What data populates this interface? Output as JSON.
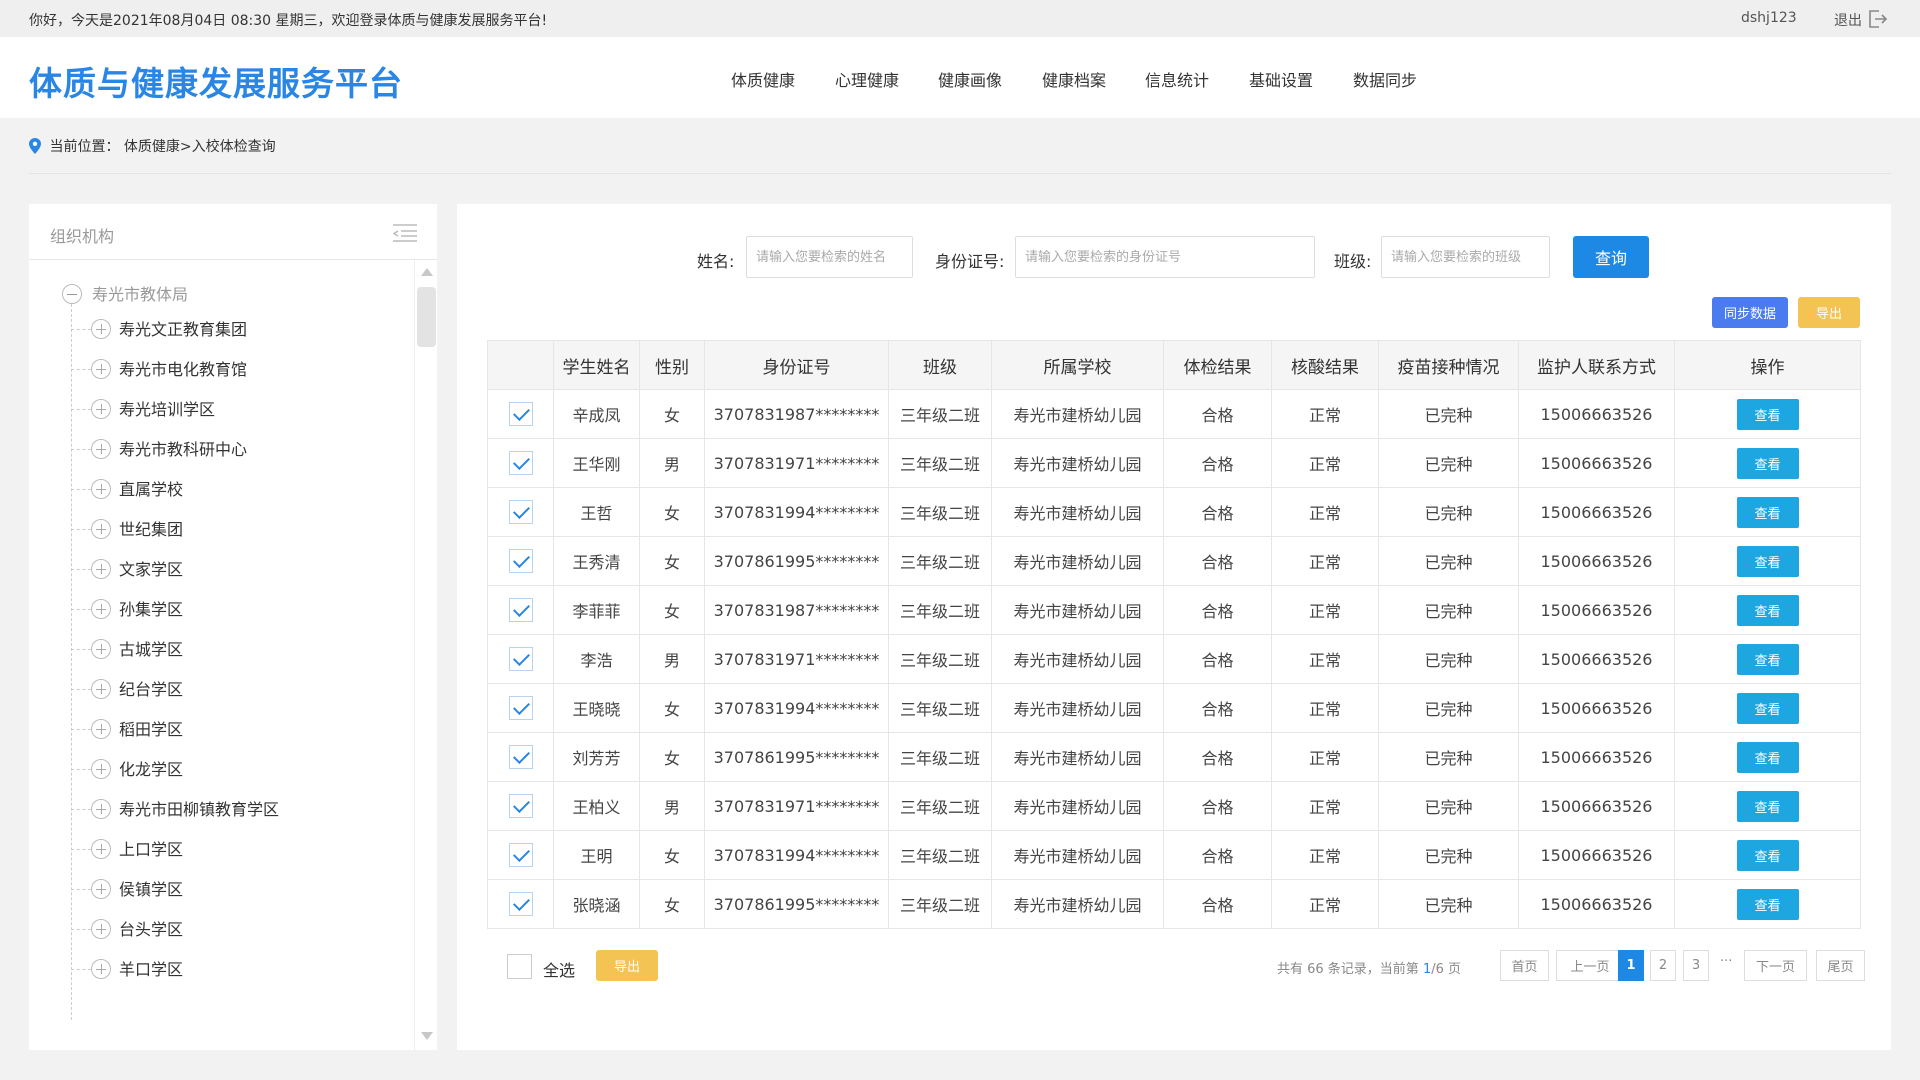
{
  "topbar": {
    "greeting": "你好，今天是2021年08月04日 08:30  星期三，欢迎登录体质与健康发展服务平台!",
    "username": "dshj123",
    "logout": "退出"
  },
  "brand": "体质与健康发展服务平台",
  "nav": [
    "体质健康",
    "心理健康",
    "健康画像",
    "健康档案",
    "信息统计",
    "基础设置",
    "数据同步"
  ],
  "breadcrumb": "当前位置：  体质健康>入校体检查询",
  "org": {
    "title": "组织机构",
    "root": "寿光市教体局",
    "items": [
      "寿光文正教育集团",
      "寿光市电化教育馆",
      "寿光培训学区",
      "寿光市教科研中心",
      "直属学校",
      "世纪集团",
      "文家学区",
      "孙集学区",
      "古城学区",
      "纪台学区",
      "稻田学区",
      "化龙学区",
      "寿光市田柳镇教育学区",
      "上口学区",
      "侯镇学区",
      "台头学区",
      "羊口学区"
    ]
  },
  "search": {
    "name_label": "姓名:",
    "name_placeholder": "请输入您要检索的姓名",
    "id_label": "身份证号:",
    "id_placeholder": "请输入您要检索的身份证号",
    "class_label": "班级:",
    "class_placeholder": "请输入您要检索的班级",
    "button": "查询"
  },
  "actions": {
    "sync": "同步数据",
    "export": "导出"
  },
  "table": {
    "columns": [
      "学生姓名",
      "性别",
      "身份证号",
      "班级",
      "所属学校",
      "体检结果",
      "核酸结果",
      "疫苗接种情况",
      "监护人联系方式",
      "操作"
    ],
    "view_label": "查看",
    "rows": [
      [
        "辛成凤",
        "女",
        "3707831987********",
        "三年级二班",
        "寿光市建桥幼儿园",
        "合格",
        "正常",
        "已完种",
        "15006663526"
      ],
      [
        "王华刚",
        "男",
        "3707831971********",
        "三年级二班",
        "寿光市建桥幼儿园",
        "合格",
        "正常",
        "已完种",
        "15006663526"
      ],
      [
        "王哲",
        "女",
        "3707831994********",
        "三年级二班",
        "寿光市建桥幼儿园",
        "合格",
        "正常",
        "已完种",
        "15006663526"
      ],
      [
        "王秀清",
        "女",
        "3707861995********",
        "三年级二班",
        "寿光市建桥幼儿园",
        "合格",
        "正常",
        "已完种",
        "15006663526"
      ],
      [
        "李菲菲",
        "女",
        "3707831987********",
        "三年级二班",
        "寿光市建桥幼儿园",
        "合格",
        "正常",
        "已完种",
        "15006663526"
      ],
      [
        "李浩",
        "男",
        "3707831971********",
        "三年级二班",
        "寿光市建桥幼儿园",
        "合格",
        "正常",
        "已完种",
        "15006663526"
      ],
      [
        "王晓晓",
        "女",
        "3707831994********",
        "三年级二班",
        "寿光市建桥幼儿园",
        "合格",
        "正常",
        "已完种",
        "15006663526"
      ],
      [
        "刘芳芳",
        "女",
        "3707861995********",
        "三年级二班",
        "寿光市建桥幼儿园",
        "合格",
        "正常",
        "已完种",
        "15006663526"
      ],
      [
        "王柏义",
        "男",
        "3707831971********",
        "三年级二班",
        "寿光市建桥幼儿园",
        "合格",
        "正常",
        "已完种",
        "15006663526"
      ],
      [
        "王明",
        "女",
        "3707831994********",
        "三年级二班",
        "寿光市建桥幼儿园",
        "合格",
        "正常",
        "已完种",
        "15006663526"
      ],
      [
        "张晓涵",
        "女",
        "3707861995********",
        "三年级二班",
        "寿光市建桥幼儿园",
        "合格",
        "正常",
        "已完种",
        "15006663526"
      ]
    ]
  },
  "footer": {
    "select_all": "全选",
    "export": "导出",
    "info_prefix": "共有 66 条记录，当前第 ",
    "info_current": "1",
    "info_suffix": "/6 页",
    "first": "首页",
    "prev": "上一页",
    "pages": [
      "1",
      "2",
      "3"
    ],
    "ellipsis": "···",
    "next": "下一页",
    "last": "尾页"
  },
  "colors": {
    "brand": "#2a86e4",
    "primary_button": "#1e88e5",
    "view_button": "#1ea6e0",
    "sync_button": "#4a7cf0",
    "export_button": "#f3c454"
  },
  "icons": {
    "logout": "logout-icon",
    "location": "location-pin-icon",
    "menu": "list-menu-icon",
    "check": "checkbox-checked-icon"
  }
}
